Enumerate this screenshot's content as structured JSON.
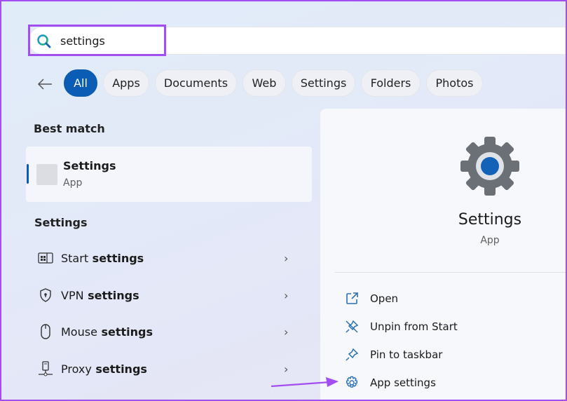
{
  "search": {
    "value": "settings",
    "icon": "search-icon"
  },
  "filters": [
    {
      "label": "All",
      "active": true
    },
    {
      "label": "Apps"
    },
    {
      "label": "Documents"
    },
    {
      "label": "Web"
    },
    {
      "label": "Settings"
    },
    {
      "label": "Folders"
    },
    {
      "label": "Photos"
    }
  ],
  "best_match": {
    "heading": "Best match",
    "title": "Settings",
    "subtitle": "App"
  },
  "settings_section": {
    "heading": "Settings",
    "items": [
      {
        "prefix": "Start",
        "bold": " settings",
        "icon": "start-layout-icon"
      },
      {
        "prefix": "VPN",
        "bold": " settings",
        "icon": "shield-icon"
      },
      {
        "prefix": "Mouse",
        "bold": " settings",
        "icon": "mouse-icon"
      },
      {
        "prefix": "Proxy",
        "bold": " settings",
        "icon": "proxy-icon"
      }
    ]
  },
  "detail": {
    "title": "Settings",
    "subtitle": "App",
    "actions": [
      {
        "label": "Open",
        "icon": "open-external-icon"
      },
      {
        "label": "Unpin from Start",
        "icon": "unpin-icon"
      },
      {
        "label": "Pin to taskbar",
        "icon": "pin-icon"
      },
      {
        "label": "App settings",
        "icon": "gear-icon"
      }
    ]
  },
  "colors": {
    "accent": "#0b5cb5",
    "highlight": "#a24ef0",
    "icon_blue": "#2a6fb5"
  }
}
